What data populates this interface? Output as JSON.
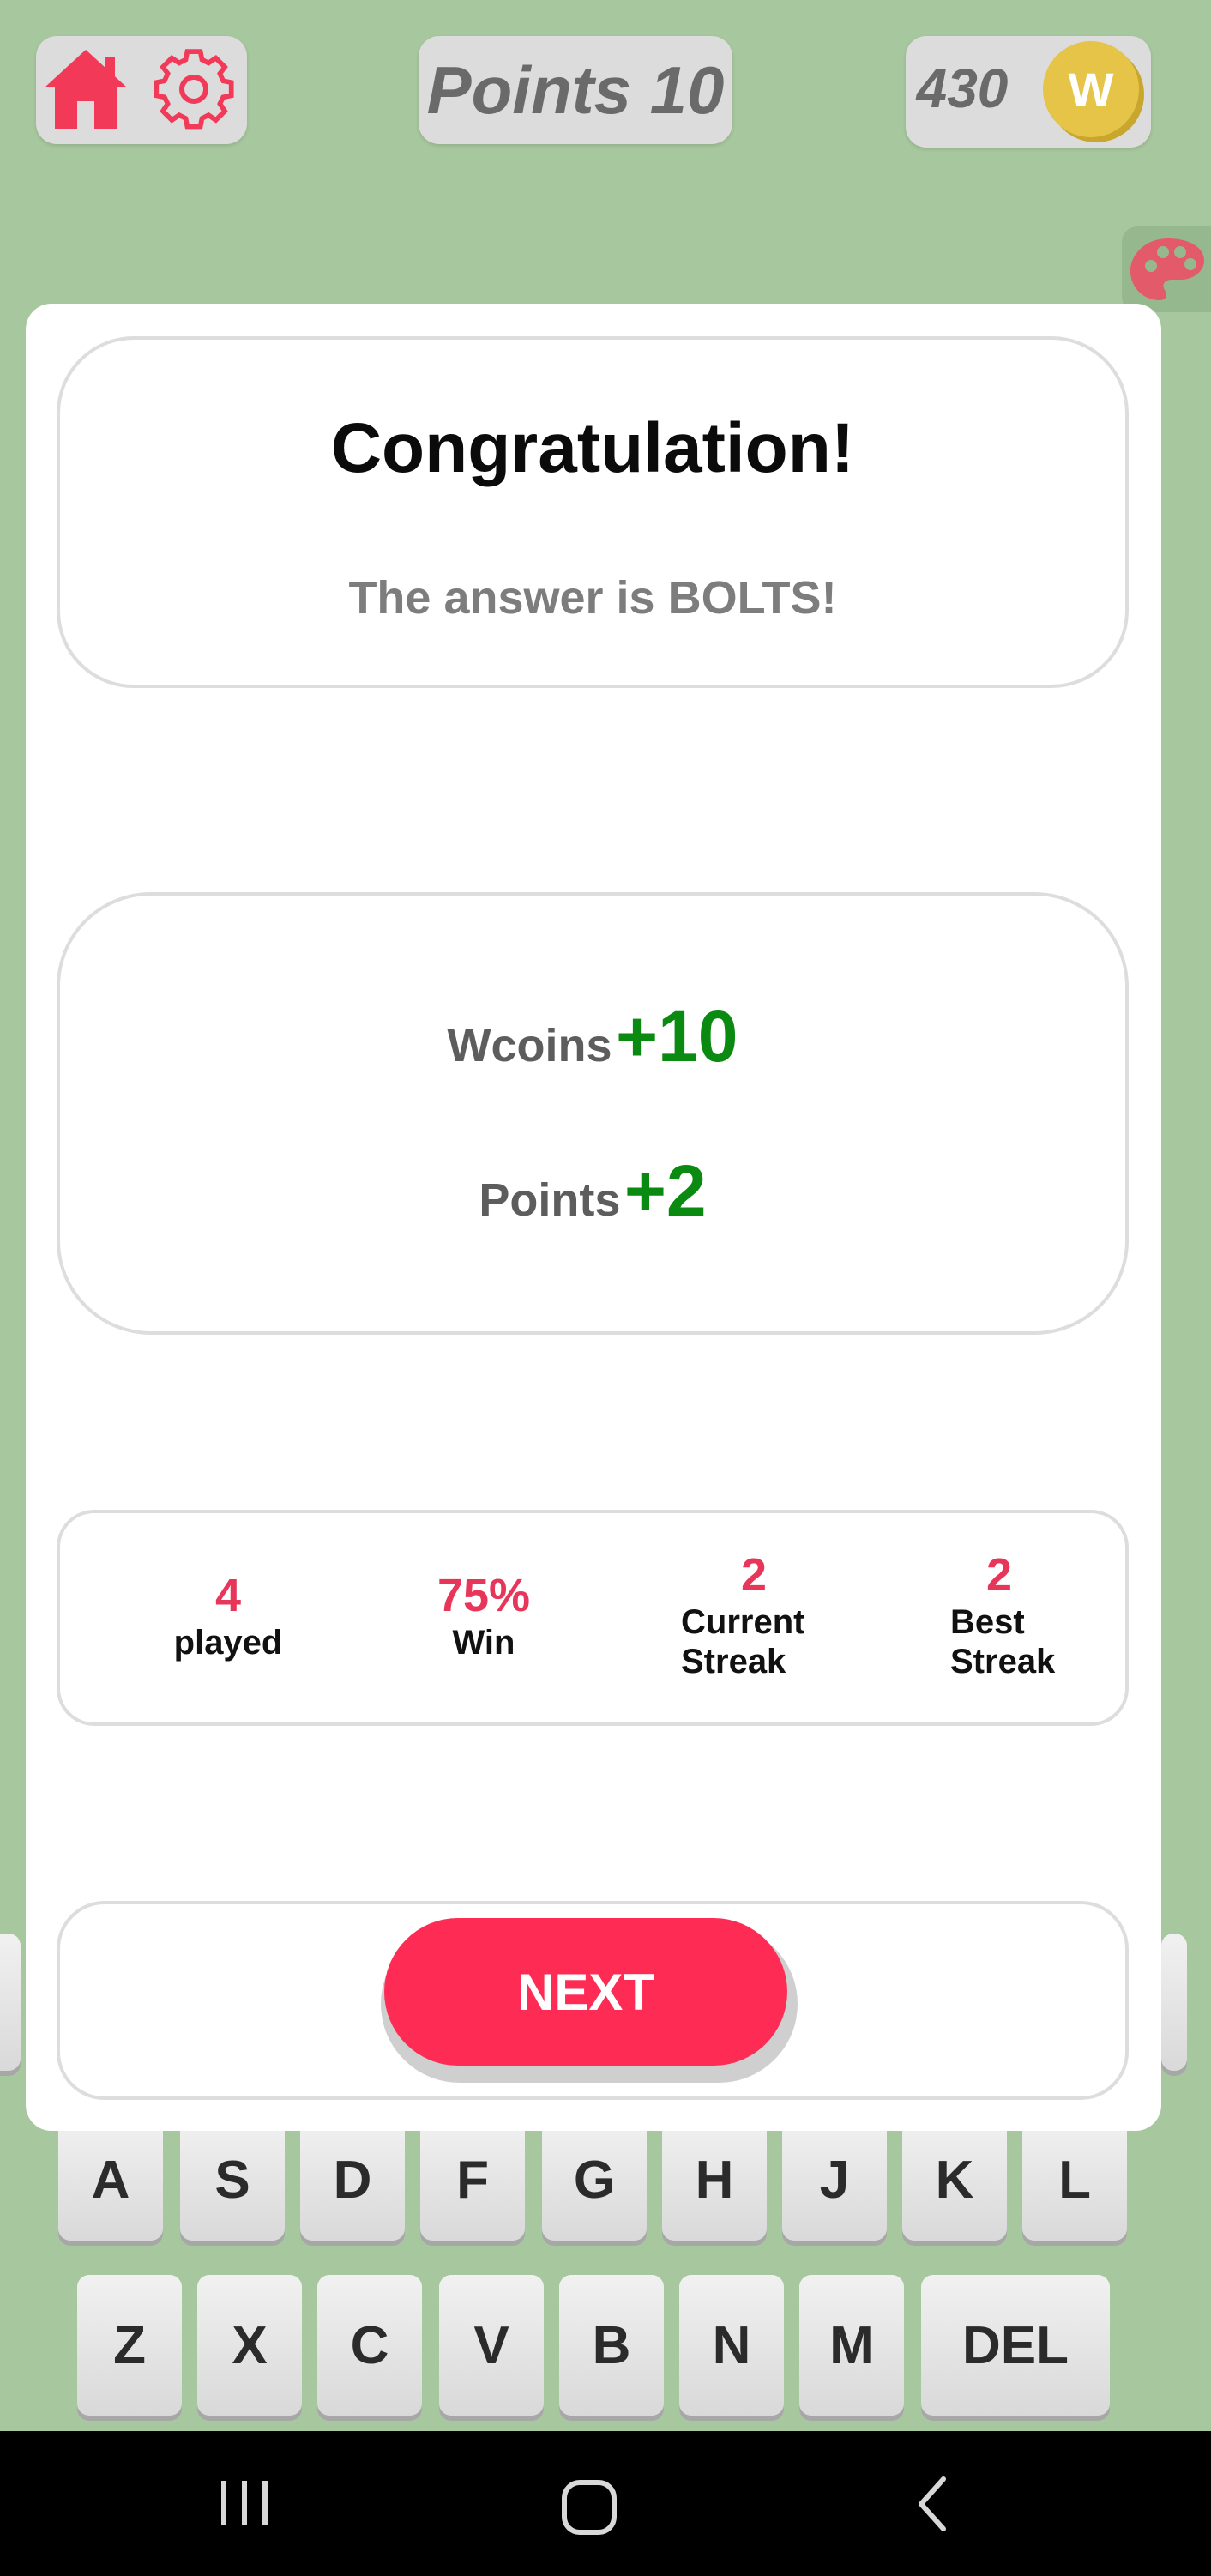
{
  "header": {
    "points_label": "Points 10",
    "coins_value": "430",
    "coin_letter": "W"
  },
  "dialog": {
    "title": "Congratulation!",
    "answer": "The answer is BOLTS!",
    "rewards": {
      "wcoins_label": "Wcoins",
      "wcoins_value": "+10",
      "points_label": "Points",
      "points_value": "+2"
    },
    "stats": {
      "played_value": "4",
      "played_label": "played",
      "win_value": "75%",
      "win_label": "Win",
      "current_value": "2",
      "current_label_1": "Current",
      "current_label_2": "Streak",
      "best_value": "2",
      "best_label_1": "Best",
      "best_label_2": "Streak"
    },
    "next_label": "NEXT"
  },
  "keyboard": {
    "row2": [
      "A",
      "S",
      "D",
      "F",
      "G",
      "H",
      "J",
      "K",
      "L"
    ],
    "row3": [
      "Z",
      "X",
      "C",
      "V",
      "B",
      "N",
      "M",
      "DEL"
    ]
  },
  "colors": {
    "background": "#a7c79e",
    "accent": "#fe2c55",
    "reward_green": "#0a8a10",
    "stat_pink": "#e8365a",
    "coin_gold": "#e6c447"
  }
}
